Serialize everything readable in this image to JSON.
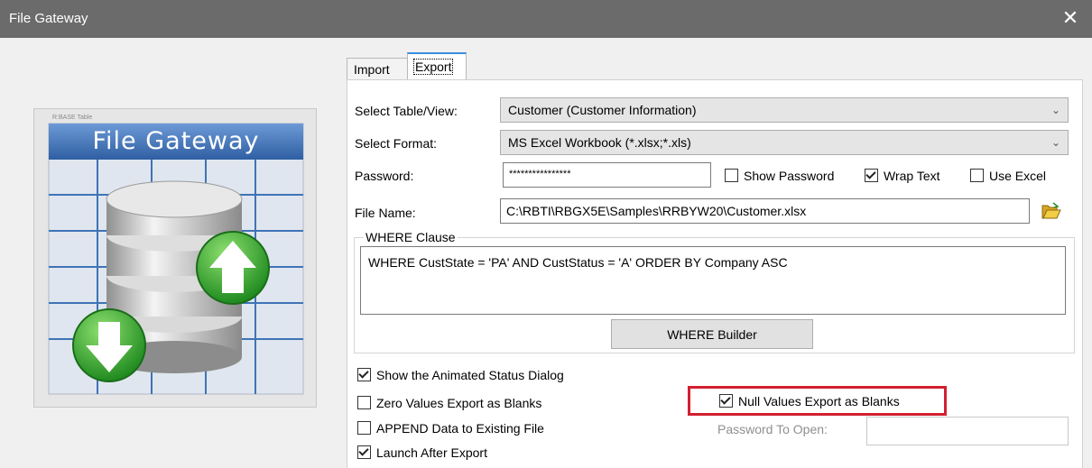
{
  "window": {
    "title": "File Gateway",
    "close_glyph": "✕"
  },
  "image": {
    "caption": "R:BASE Table",
    "heading": "File Gateway"
  },
  "tabs": [
    {
      "label": "Import"
    },
    {
      "label": "Export"
    }
  ],
  "form": {
    "table_label": "Select Table/View:",
    "table_value": "Customer  (Customer Information)",
    "format_label": "Select Format:",
    "format_value": "MS Excel Workbook (*.xlsx;*.xls)",
    "password_label": "Password:",
    "password_value": "****************",
    "show_password": "Show Password",
    "wrap_text": "Wrap Text",
    "use_excel": "Use Excel",
    "file_label": "File Name:",
    "file_value": "C:\\RBTI\\RBGX5E\\Samples\\RRBYW20\\Customer.xlsx",
    "where_legend": "WHERE Clause",
    "where_text": "WHERE CustState  = 'PA'   AND  CustStatus  = 'A' ORDER BY Company ASC",
    "where_builder": "WHERE Builder"
  },
  "options": {
    "animated": "Show the Animated Status Dialog",
    "zero": "Zero Values Export as Blanks",
    "append": "APPEND Data to Existing File",
    "launch": "Launch After Export",
    "null": "Null Values Export as Blanks",
    "password_open": "Password To Open:"
  },
  "checked": {
    "show_password": false,
    "wrap_text": true,
    "use_excel": false,
    "animated": true,
    "zero": false,
    "append": false,
    "launch": true,
    "null": true
  },
  "colors": {
    "titlebar": "#6b6b6b",
    "tab_accent": "#3c8de0",
    "highlight": "#d2202f",
    "banner": "#3f73b6"
  },
  "icons": {
    "close": "close-icon",
    "folder": "folder-open-icon",
    "arrow_up": "arrow-up-icon",
    "arrow_down": "arrow-down-icon",
    "chevron": "chevron-down-icon"
  }
}
